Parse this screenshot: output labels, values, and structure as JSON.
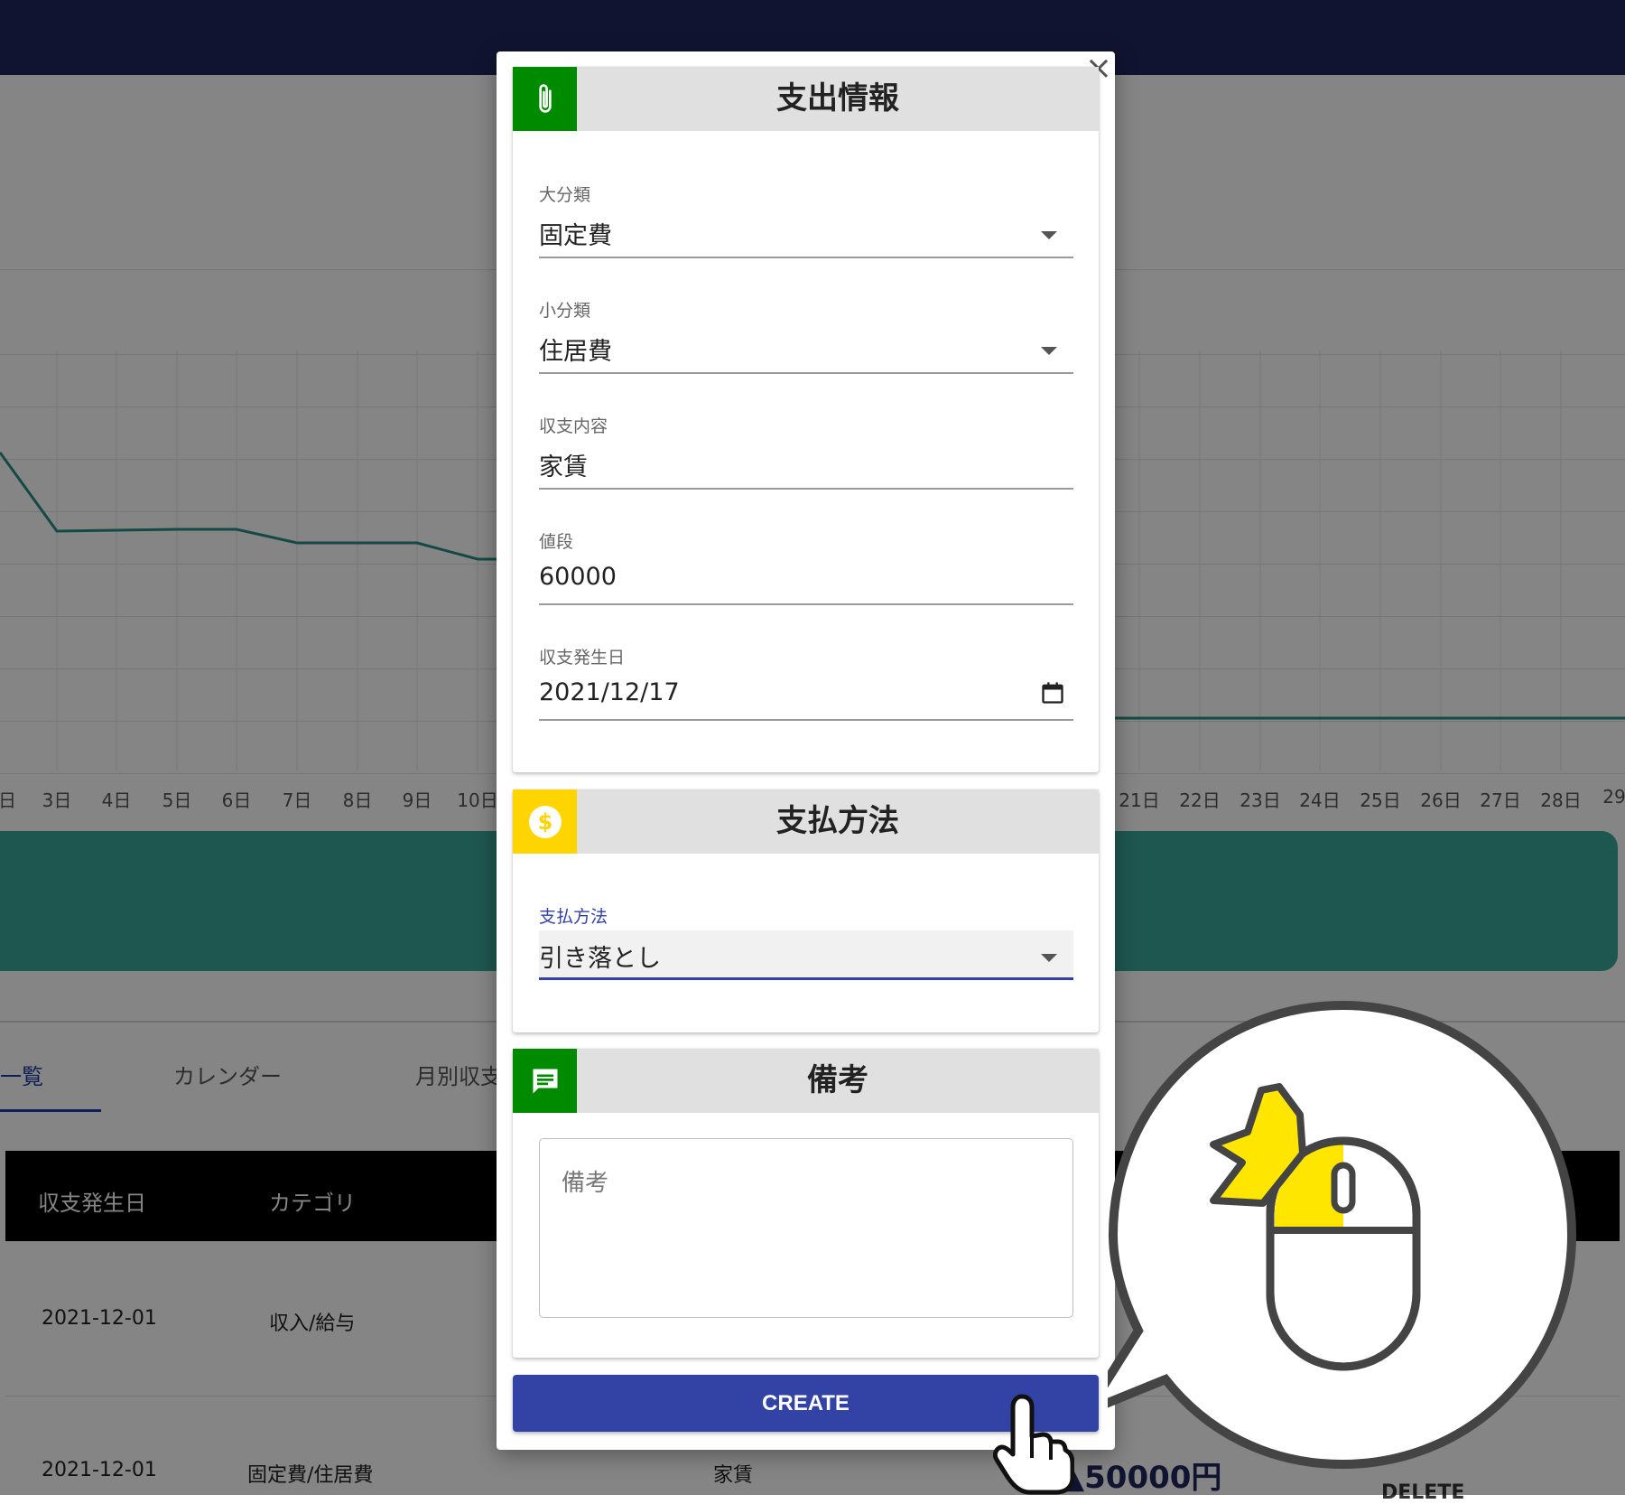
{
  "background": {
    "chart": {
      "x_labels": [
        "日",
        "3日",
        "4日",
        "5日",
        "6日",
        "7日",
        "8日",
        "9日",
        "10日",
        "21日",
        "22日",
        "23日",
        "24日",
        "25日",
        "26日",
        "27日",
        "28日",
        "29"
      ]
    },
    "tabs": [
      "一覧",
      "カレンダー",
      "月別収支"
    ],
    "table": {
      "headers": [
        "収支発生日",
        "カテゴリ"
      ],
      "rows": [
        {
          "date": "2021-12-01",
          "category": "収入/給与",
          "content": ""
        },
        {
          "date": "2021-12-01",
          "category": "固定費/住居費",
          "content": "家賃",
          "amount": "▲50000円"
        }
      ]
    },
    "row_action_label": "DELETE"
  },
  "modal": {
    "close_icon": "close-icon",
    "expense_card": {
      "title": "支出情報",
      "icon": "paperclip-icon",
      "icon_bg": "#008a00",
      "fields": {
        "major_category": {
          "label": "大分類",
          "value": "固定費"
        },
        "minor_category": {
          "label": "小分類",
          "value": "住居費"
        },
        "content": {
          "label": "収支内容",
          "value": "家賃"
        },
        "price": {
          "label": "値段",
          "value": "60000"
        },
        "date": {
          "label": "収支発生日",
          "value": "2021/12/17"
        }
      }
    },
    "payment_card": {
      "title": "支払方法",
      "icon": "dollar-icon",
      "icon_bg": "#ffd500",
      "field": {
        "label": "支払方法",
        "value": "引き落とし"
      }
    },
    "notes_card": {
      "title": "備考",
      "icon": "comment-icon",
      "icon_bg": "#008a00",
      "placeholder": "備考"
    },
    "create_label": "CREATE"
  },
  "colors": {
    "accent": "#3342a5",
    "appbar": "#1f285c",
    "line": "#2a8d84",
    "banner": "#3aa89a"
  }
}
